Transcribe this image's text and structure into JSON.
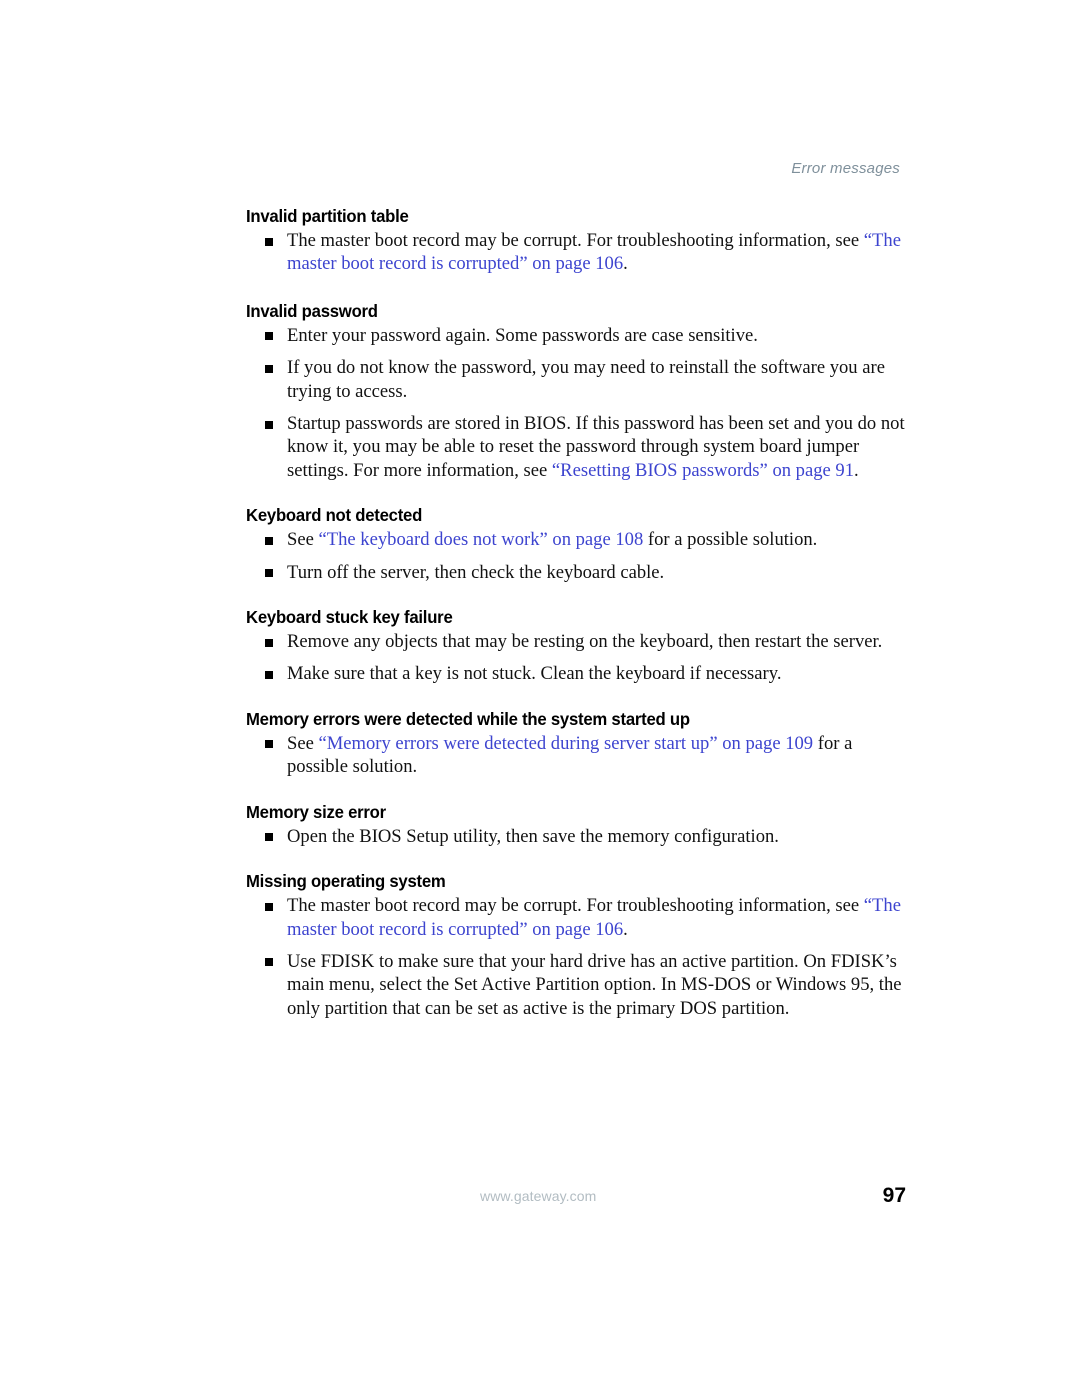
{
  "header": {
    "running_title": "Error messages"
  },
  "footer": {
    "url": "www.gateway.com",
    "page_number": "97"
  },
  "colors": {
    "link": "#3d44cf",
    "running_header": "#7f909b",
    "footer_url": "#b2bcc2",
    "body_text": "#111111",
    "page_background": "#ffffff"
  },
  "icons": {
    "bullet": "square-bullet-icon"
  },
  "sections": [
    {
      "heading": "Invalid partition table",
      "bullets": [
        {
          "parts": [
            {
              "text": "The master boot record may be corrupt. For troubleshooting information, see ",
              "link": false
            },
            {
              "text": "“The master boot record is corrupted” on page 106",
              "link": true
            },
            {
              "text": ".",
              "link": false
            }
          ]
        }
      ]
    },
    {
      "heading": "Invalid password",
      "bullets": [
        {
          "parts": [
            {
              "text": "Enter your password again. Some passwords are case sensitive.",
              "link": false
            }
          ]
        },
        {
          "parts": [
            {
              "text": "If you do not know the password, you may need to reinstall the software you are trying to access.",
              "link": false
            }
          ]
        },
        {
          "parts": [
            {
              "text": "Startup passwords are stored in BIOS. If this password has been set and you do not know it, you may be able to reset the password through system board jumper settings. For more information, see ",
              "link": false
            },
            {
              "text": "“Resetting BIOS passwords” on page 91",
              "link": true
            },
            {
              "text": ".",
              "link": false
            }
          ]
        }
      ]
    },
    {
      "heading": "Keyboard not detected",
      "bullets": [
        {
          "parts": [
            {
              "text": "See ",
              "link": false
            },
            {
              "text": "“The keyboard does not work” on page 108",
              "link": true
            },
            {
              "text": " for a possible solution.",
              "link": false
            }
          ]
        },
        {
          "parts": [
            {
              "text": "Turn off the server, then check the keyboard cable.",
              "link": false
            }
          ]
        }
      ]
    },
    {
      "heading": "Keyboard stuck key failure",
      "bullets": [
        {
          "parts": [
            {
              "text": "Remove any objects that may be resting on the keyboard, then restart the server.",
              "link": false
            }
          ]
        },
        {
          "parts": [
            {
              "text": "Make sure that a key is not stuck. Clean the keyboard if necessary.",
              "link": false
            }
          ]
        }
      ]
    },
    {
      "heading": "Memory errors were detected while the system started up",
      "bullets": [
        {
          "parts": [
            {
              "text": "See ",
              "link": false
            },
            {
              "text": "“Memory errors were detected during server start up” on page 109",
              "link": true
            },
            {
              "text": " for a possible solution.",
              "link": false
            }
          ]
        }
      ]
    },
    {
      "heading": "Memory size error",
      "bullets": [
        {
          "parts": [
            {
              "text": "Open the BIOS Setup utility, then save the memory configuration.",
              "link": false
            }
          ]
        }
      ]
    },
    {
      "heading": "Missing operating system",
      "bullets": [
        {
          "parts": [
            {
              "text": "The master boot record may be corrupt. For troubleshooting information, see ",
              "link": false
            },
            {
              "text": "“The master boot record is corrupted” on page 106",
              "link": true
            },
            {
              "text": ".",
              "link": false
            }
          ]
        },
        {
          "parts": [
            {
              "text": "Use FDISK to make sure that your hard drive has an active partition. On FDISK’s main menu, select the Set Active Partition option. In MS-DOS or Windows 95, the only partition that can be set as active is the primary DOS partition.",
              "link": false
            }
          ]
        }
      ]
    }
  ]
}
